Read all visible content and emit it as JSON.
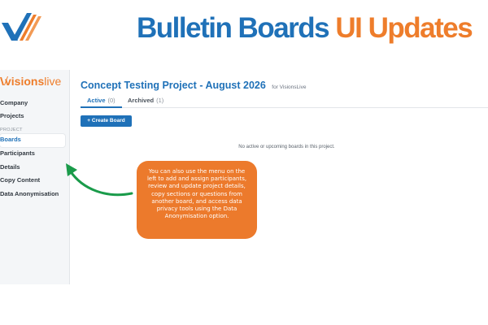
{
  "banner": {
    "title_part1": "Bulletin Boards",
    "title_part2": "UI Updates",
    "logo": "visionslive-v-logo"
  },
  "sidebar": {
    "brand_part1": "visions",
    "brand_part2": "live",
    "items_top": [
      {
        "label": "Company"
      },
      {
        "label": "Projects"
      }
    ],
    "section_label": "PROJECT",
    "items": [
      {
        "label": "Boards",
        "active": true
      },
      {
        "label": "Participants"
      },
      {
        "label": "Details"
      },
      {
        "label": "Copy Content"
      },
      {
        "label": "Data Anonymisation"
      }
    ]
  },
  "main": {
    "project_name": "Concept Testing Project - August 2026",
    "project_owner": "for VisionsLive",
    "tabs": [
      {
        "label": "Active",
        "count": "(0)",
        "active": true
      },
      {
        "label": "Archived",
        "count": "(1)",
        "active": false
      }
    ],
    "create_button": "+ Create Board",
    "empty_message": "No active or upcoming boards in this project."
  },
  "callout": {
    "text": "You can also use the menu on the left to add and assign participants, review and update project details, copy sections or questions from another board, and access data privacy tools using the Data Anonymisation option."
  },
  "colors": {
    "brand_blue": "#1f71b8",
    "brand_orange": "#ee7d2b",
    "callout_orange": "#ec7a2c",
    "arrow_green": "#1a9b4a"
  },
  "icons": [
    "visionslive-logo-icon",
    "arrow-icon"
  ]
}
